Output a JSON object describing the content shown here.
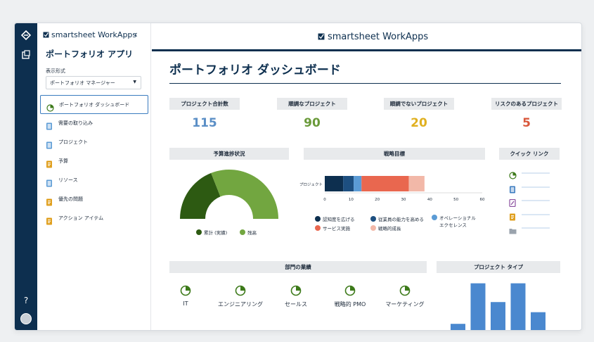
{
  "sidebar": {
    "brand": "smartsheet WorkApps",
    "app_title": "ポートフォリオ アプリ",
    "view_label": "表示形式",
    "view_value": "ポートフォリオ マネージャー",
    "items": [
      {
        "label": "ポートフォリオ ダッシュボード",
        "icon": "dashboard-icon"
      },
      {
        "label": "需要の取り込み",
        "icon": "form-icon"
      },
      {
        "label": "プロジェクト",
        "icon": "sheet-icon"
      },
      {
        "label": "予算",
        "icon": "report-icon"
      },
      {
        "label": "リソース",
        "icon": "sheet-icon"
      },
      {
        "label": "優先の問題",
        "icon": "report-icon"
      },
      {
        "label": "アクション アイテム",
        "icon": "report-icon"
      }
    ],
    "help": "?"
  },
  "header": {
    "brand": "smartsheet WorkApps",
    "dashboard_title": "ポートフォリオ ダッシュボード"
  },
  "stats": [
    {
      "label": "プロジェクト合計数",
      "value": "115",
      "color": "#5b8fc6"
    },
    {
      "label": "順調なプロジェクト",
      "value": "90",
      "color": "#6a9a3a"
    },
    {
      "label": "順調でないプロジェクト",
      "value": "20",
      "color": "#e0b020"
    },
    {
      "label": "リスクのあるプロジェクト",
      "value": "5",
      "color": "#d9583c"
    }
  ],
  "budget": {
    "title": "予算進捗状況",
    "legend": [
      {
        "label": "累計 (実績)",
        "color": "#2d5a12"
      },
      {
        "label": "残高",
        "color": "#72a640"
      }
    ],
    "spent_fraction": 0.38
  },
  "strategy": {
    "title": "戦略目標",
    "row_label": "プロジェクト",
    "ticks": [
      "0",
      "10",
      "20",
      "30",
      "40",
      "50",
      "60"
    ],
    "segments": [
      {
        "value": 7,
        "color": "#0d2f4f"
      },
      {
        "value": 4,
        "color": "#1d4f80"
      },
      {
        "value": 3,
        "color": "#5b9bd5"
      },
      {
        "value": 18,
        "color": "#e9674f"
      },
      {
        "value": 6,
        "color": "#f2b8a8"
      }
    ],
    "legend": [
      {
        "label": "認知度を広げる",
        "color": "#0d2f4f"
      },
      {
        "label": "従業員の能力を高める",
        "color": "#1d4f80"
      },
      {
        "label": "オペレーショナル",
        "label2": "エクセレンス",
        "color": "#5b9bd5"
      },
      {
        "label": "サービス実施",
        "color": "#e9674f"
      },
      {
        "label": "戦略的成長",
        "color": "#f2b8a8"
      }
    ]
  },
  "quick_links": {
    "title": "クイック リンク",
    "items": [
      {
        "icon": "dashboard-icon",
        "color": "#3d7a1a"
      },
      {
        "icon": "form-icon",
        "color": "#3a7bbf"
      },
      {
        "icon": "edit-icon",
        "color": "#8b4f9f"
      },
      {
        "icon": "report-icon",
        "color": "#e0a020"
      },
      {
        "icon": "folder-icon",
        "color": "#9aa3ad"
      }
    ]
  },
  "departments": {
    "title": "部門の業績",
    "items": [
      {
        "label": "IT"
      },
      {
        "label": "エンジニアリング"
      },
      {
        "label": "セールス"
      },
      {
        "label": "戦略的 PMO"
      },
      {
        "label": "マーケティング"
      }
    ]
  },
  "project_types": {
    "title": "プロジェクト タイプ",
    "values": [
      15,
      95,
      58,
      95,
      38
    ],
    "color": "#4a88cf"
  }
}
